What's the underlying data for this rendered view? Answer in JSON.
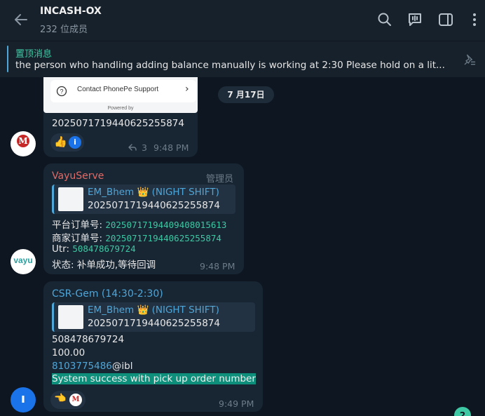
{
  "header": {
    "title": "INCASH-OX",
    "subtitle": "232 位成员"
  },
  "pinned": {
    "label": "置顶消息",
    "text": "the person who handling adding balance manually is working at 2:30  Please hold on a lit..."
  },
  "date_chip": "7 月17日",
  "msg1": {
    "support_label": "Contact PhonePe Support",
    "powered_by": "Powered by",
    "text": "20250717194406252558 74",
    "text_full": "2025071719440625255874",
    "reply_count": "3",
    "time": "9:48 PM",
    "avatar_text": "M"
  },
  "msg2": {
    "sender": "VayuServe",
    "role": "管理员",
    "reply_name": "EM_Bhem 👑 (NIGHT SHIFT)",
    "reply_text": "2025071719440625255874",
    "platform_label": "平台订单号: ",
    "platform_value": "2025071719440940801561 3",
    "platform_value_full": "20250717194409408015613",
    "merchant_label": "商家订单号: ",
    "merchant_value": "2025071719440625255874",
    "utr_label": "Utr: ",
    "utr_value": "508478679724",
    "status_text": "状态: 补单成功,等待回调",
    "time": "9:48 PM",
    "avatar_text": "vayu"
  },
  "msg3": {
    "sender": "CSR-Gem (14:30-2:30)",
    "reply_name": "EM_Bhem 👑 (NIGHT SHIFT)",
    "reply_text": "2025071719440625255874",
    "line1": "508478679724",
    "line2": "100.00",
    "line3_link": "8103775486",
    "line3_rest": "@ibl",
    "line4": "System success with pick up order number",
    "time": "9:49 PM"
  },
  "unread_badge": "2",
  "colors": {
    "background": "#0e1621",
    "bubble": "#182533",
    "accent": "#4fa6d8",
    "green": "#3ec8a4",
    "sender_red": "#e06b67"
  }
}
